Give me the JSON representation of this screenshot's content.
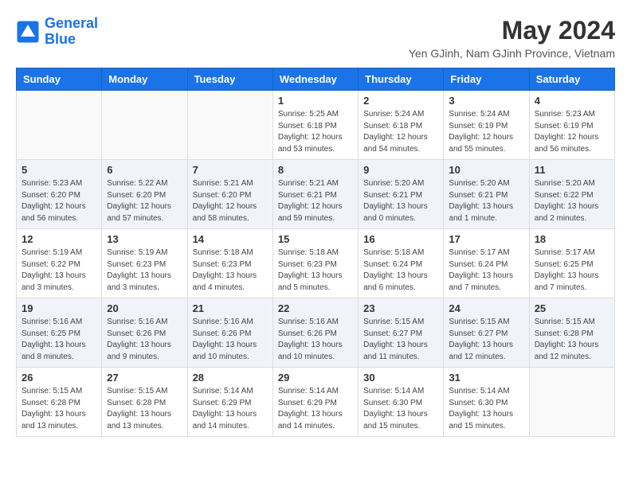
{
  "header": {
    "logo_line1": "General",
    "logo_line2": "Blue",
    "month_year": "May 2024",
    "location": "Yen GJinh, Nam GJinh Province, Vietnam"
  },
  "weekdays": [
    "Sunday",
    "Monday",
    "Tuesday",
    "Wednesday",
    "Thursday",
    "Friday",
    "Saturday"
  ],
  "weeks": [
    [
      {
        "day": "",
        "info": ""
      },
      {
        "day": "",
        "info": ""
      },
      {
        "day": "",
        "info": ""
      },
      {
        "day": "1",
        "info": "Sunrise: 5:25 AM\nSunset: 6:18 PM\nDaylight: 12 hours\nand 53 minutes."
      },
      {
        "day": "2",
        "info": "Sunrise: 5:24 AM\nSunset: 6:18 PM\nDaylight: 12 hours\nand 54 minutes."
      },
      {
        "day": "3",
        "info": "Sunrise: 5:24 AM\nSunset: 6:19 PM\nDaylight: 12 hours\nand 55 minutes."
      },
      {
        "day": "4",
        "info": "Sunrise: 5:23 AM\nSunset: 6:19 PM\nDaylight: 12 hours\nand 56 minutes."
      }
    ],
    [
      {
        "day": "5",
        "info": "Sunrise: 5:23 AM\nSunset: 6:20 PM\nDaylight: 12 hours\nand 56 minutes."
      },
      {
        "day": "6",
        "info": "Sunrise: 5:22 AM\nSunset: 6:20 PM\nDaylight: 12 hours\nand 57 minutes."
      },
      {
        "day": "7",
        "info": "Sunrise: 5:21 AM\nSunset: 6:20 PM\nDaylight: 12 hours\nand 58 minutes."
      },
      {
        "day": "8",
        "info": "Sunrise: 5:21 AM\nSunset: 6:21 PM\nDaylight: 12 hours\nand 59 minutes."
      },
      {
        "day": "9",
        "info": "Sunrise: 5:20 AM\nSunset: 6:21 PM\nDaylight: 13 hours\nand 0 minutes."
      },
      {
        "day": "10",
        "info": "Sunrise: 5:20 AM\nSunset: 6:21 PM\nDaylight: 13 hours\nand 1 minute."
      },
      {
        "day": "11",
        "info": "Sunrise: 5:20 AM\nSunset: 6:22 PM\nDaylight: 13 hours\nand 2 minutes."
      }
    ],
    [
      {
        "day": "12",
        "info": "Sunrise: 5:19 AM\nSunset: 6:22 PM\nDaylight: 13 hours\nand 3 minutes."
      },
      {
        "day": "13",
        "info": "Sunrise: 5:19 AM\nSunset: 6:23 PM\nDaylight: 13 hours\nand 3 minutes."
      },
      {
        "day": "14",
        "info": "Sunrise: 5:18 AM\nSunset: 6:23 PM\nDaylight: 13 hours\nand 4 minutes."
      },
      {
        "day": "15",
        "info": "Sunrise: 5:18 AM\nSunset: 6:23 PM\nDaylight: 13 hours\nand 5 minutes."
      },
      {
        "day": "16",
        "info": "Sunrise: 5:18 AM\nSunset: 6:24 PM\nDaylight: 13 hours\nand 6 minutes."
      },
      {
        "day": "17",
        "info": "Sunrise: 5:17 AM\nSunset: 6:24 PM\nDaylight: 13 hours\nand 7 minutes."
      },
      {
        "day": "18",
        "info": "Sunrise: 5:17 AM\nSunset: 6:25 PM\nDaylight: 13 hours\nand 7 minutes."
      }
    ],
    [
      {
        "day": "19",
        "info": "Sunrise: 5:16 AM\nSunset: 6:25 PM\nDaylight: 13 hours\nand 8 minutes."
      },
      {
        "day": "20",
        "info": "Sunrise: 5:16 AM\nSunset: 6:26 PM\nDaylight: 13 hours\nand 9 minutes."
      },
      {
        "day": "21",
        "info": "Sunrise: 5:16 AM\nSunset: 6:26 PM\nDaylight: 13 hours\nand 10 minutes."
      },
      {
        "day": "22",
        "info": "Sunrise: 5:16 AM\nSunset: 6:26 PM\nDaylight: 13 hours\nand 10 minutes."
      },
      {
        "day": "23",
        "info": "Sunrise: 5:15 AM\nSunset: 6:27 PM\nDaylight: 13 hours\nand 11 minutes."
      },
      {
        "day": "24",
        "info": "Sunrise: 5:15 AM\nSunset: 6:27 PM\nDaylight: 13 hours\nand 12 minutes."
      },
      {
        "day": "25",
        "info": "Sunrise: 5:15 AM\nSunset: 6:28 PM\nDaylight: 13 hours\nand 12 minutes."
      }
    ],
    [
      {
        "day": "26",
        "info": "Sunrise: 5:15 AM\nSunset: 6:28 PM\nDaylight: 13 hours\nand 13 minutes."
      },
      {
        "day": "27",
        "info": "Sunrise: 5:15 AM\nSunset: 6:28 PM\nDaylight: 13 hours\nand 13 minutes."
      },
      {
        "day": "28",
        "info": "Sunrise: 5:14 AM\nSunset: 6:29 PM\nDaylight: 13 hours\nand 14 minutes."
      },
      {
        "day": "29",
        "info": "Sunrise: 5:14 AM\nSunset: 6:29 PM\nDaylight: 13 hours\nand 14 minutes."
      },
      {
        "day": "30",
        "info": "Sunrise: 5:14 AM\nSunset: 6:30 PM\nDaylight: 13 hours\nand 15 minutes."
      },
      {
        "day": "31",
        "info": "Sunrise: 5:14 AM\nSunset: 6:30 PM\nDaylight: 13 hours\nand 15 minutes."
      },
      {
        "day": "",
        "info": ""
      }
    ]
  ]
}
